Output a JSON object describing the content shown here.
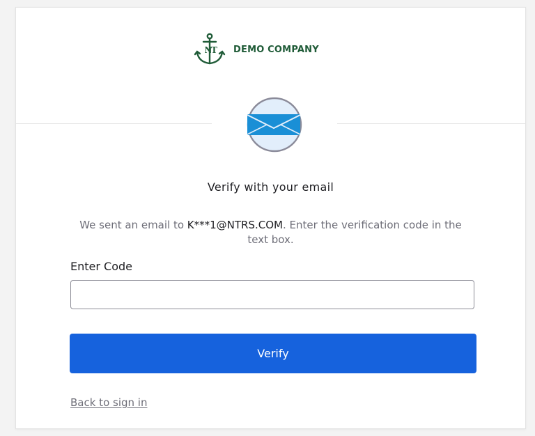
{
  "brand": {
    "name": "DEMO COMPANY",
    "color": "#1f5b37"
  },
  "icons": {
    "logo": "anchor-logo-icon",
    "factor": "email-envelope-icon"
  },
  "page": {
    "title": "Verify with your email",
    "subtitle_prefix": "We sent an email to ",
    "email": "K***1@NTRS.COM",
    "subtitle_suffix": ". Enter the verification code in the text box."
  },
  "form": {
    "code_label": "Enter Code",
    "code_value": "",
    "verify_label": "Verify",
    "back_label": "Back to sign in"
  },
  "colors": {
    "primary": "#1662dd",
    "badge_bg": "#e2eefb",
    "badge_ring": "#8a8a99",
    "envelope": "#1a8fd6"
  }
}
